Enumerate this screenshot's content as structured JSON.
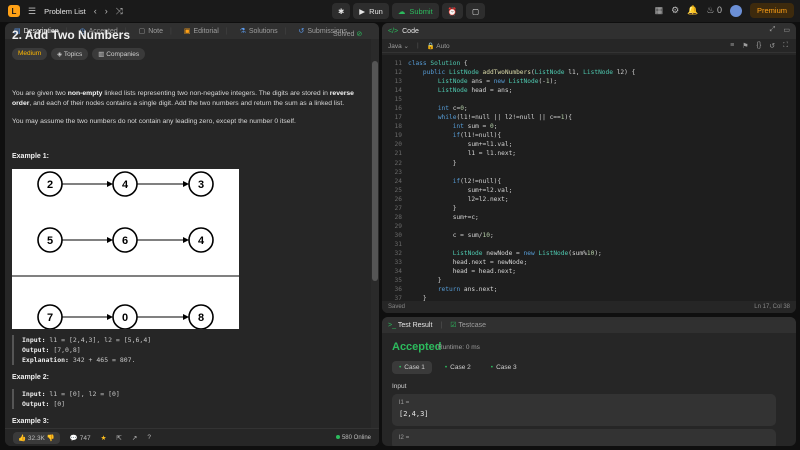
{
  "topbar": {
    "logo": "L",
    "problem_list": "Problem List",
    "run": "Run",
    "submit": "Submit",
    "streak": "0",
    "premium": "Premium"
  },
  "left_tabs": [
    {
      "label": "Description",
      "icon": "doc-icon"
    },
    {
      "label": "Accepted",
      "icon": "clock-icon"
    },
    {
      "label": "Note",
      "icon": "note-icon"
    },
    {
      "label": "Editorial",
      "icon": "book-icon"
    },
    {
      "label": "Solutions",
      "icon": "flask-icon"
    },
    {
      "label": "Submissions",
      "icon": "history-icon"
    }
  ],
  "problem": {
    "title": "2. Add Two Numbers",
    "solved": "Solved",
    "tags": [
      "Medium",
      "Topics",
      "Companies"
    ],
    "desc1_a": "You are given two ",
    "desc1_b": "non-empty",
    "desc1_c": " linked lists representing two non-negative integers. The digits are stored in ",
    "desc1_d": "reverse order",
    "desc1_e": ", and each of their nodes contains a single digit. Add the two numbers and return the sum as a linked list.",
    "desc2": "You may assume the two numbers do not contain any leading zero, except the number 0 itself.",
    "ex1_h": "Example 1:",
    "ex2_h": "Example 2:",
    "ex3_h": "Example 3:",
    "diagram_rows": [
      [
        "2",
        "4",
        "3"
      ],
      [
        "5",
        "6",
        "4"
      ],
      [
        "7",
        "0",
        "8"
      ]
    ],
    "ex1": {
      "input_label": "Input:",
      "input": " l1 = [2,4,3], l2 = [5,6,4]",
      "output_label": "Output:",
      "output": " [7,0,8]",
      "expl_label": "Explanation:",
      "expl": " 342 + 465 = 807."
    },
    "ex2": {
      "input_label": "Input:",
      "input": " l1 = [0], l2 = [0]",
      "output_label": "Output:",
      "output": " [0]"
    }
  },
  "left_footer": {
    "likes": "32.3K",
    "comments": "747",
    "online": "580 Online"
  },
  "code_panel": {
    "title": "Code",
    "language": "Java",
    "mode": "Auto",
    "saved": "Saved",
    "cursor": "Ln 17, Col 38",
    "line_start": 11,
    "lines": [
      "class Solution {",
      "    public ListNode addTwoNumbers(ListNode l1, ListNode l2) {",
      "        ListNode ans = new ListNode(-1);",
      "        ListNode head = ans;",
      "",
      "        int c=0;",
      "        while(l1!=null || l2!=null || c==1){",
      "            int sum = 0;",
      "            if(l1!=null){",
      "                sum+=l1.val;",
      "                l1 = l1.next;",
      "            }",
      "",
      "            if(l2!=null){",
      "                sum+=l2.val;",
      "                l2=l2.next;",
      "            }",
      "            sum+=c;",
      "",
      "            c = sum/10;",
      "",
      "            ListNode newNode = new ListNode(sum%10);",
      "            head.next = newNode;",
      "            head = head.next;",
      "        }",
      "        return ans.next;",
      "    }",
      "}"
    ]
  },
  "test_panel": {
    "tab_result": "Test Result",
    "tab_testcase": "Testcase",
    "status": "Accepted",
    "runtime": "Runtime: 0 ms",
    "cases": [
      "Case 1",
      "Case 2",
      "Case 3"
    ],
    "input_label": "Input",
    "var1_name": "l1 =",
    "var1_value": "[2,4,3]",
    "var2_name": "l2 ="
  }
}
